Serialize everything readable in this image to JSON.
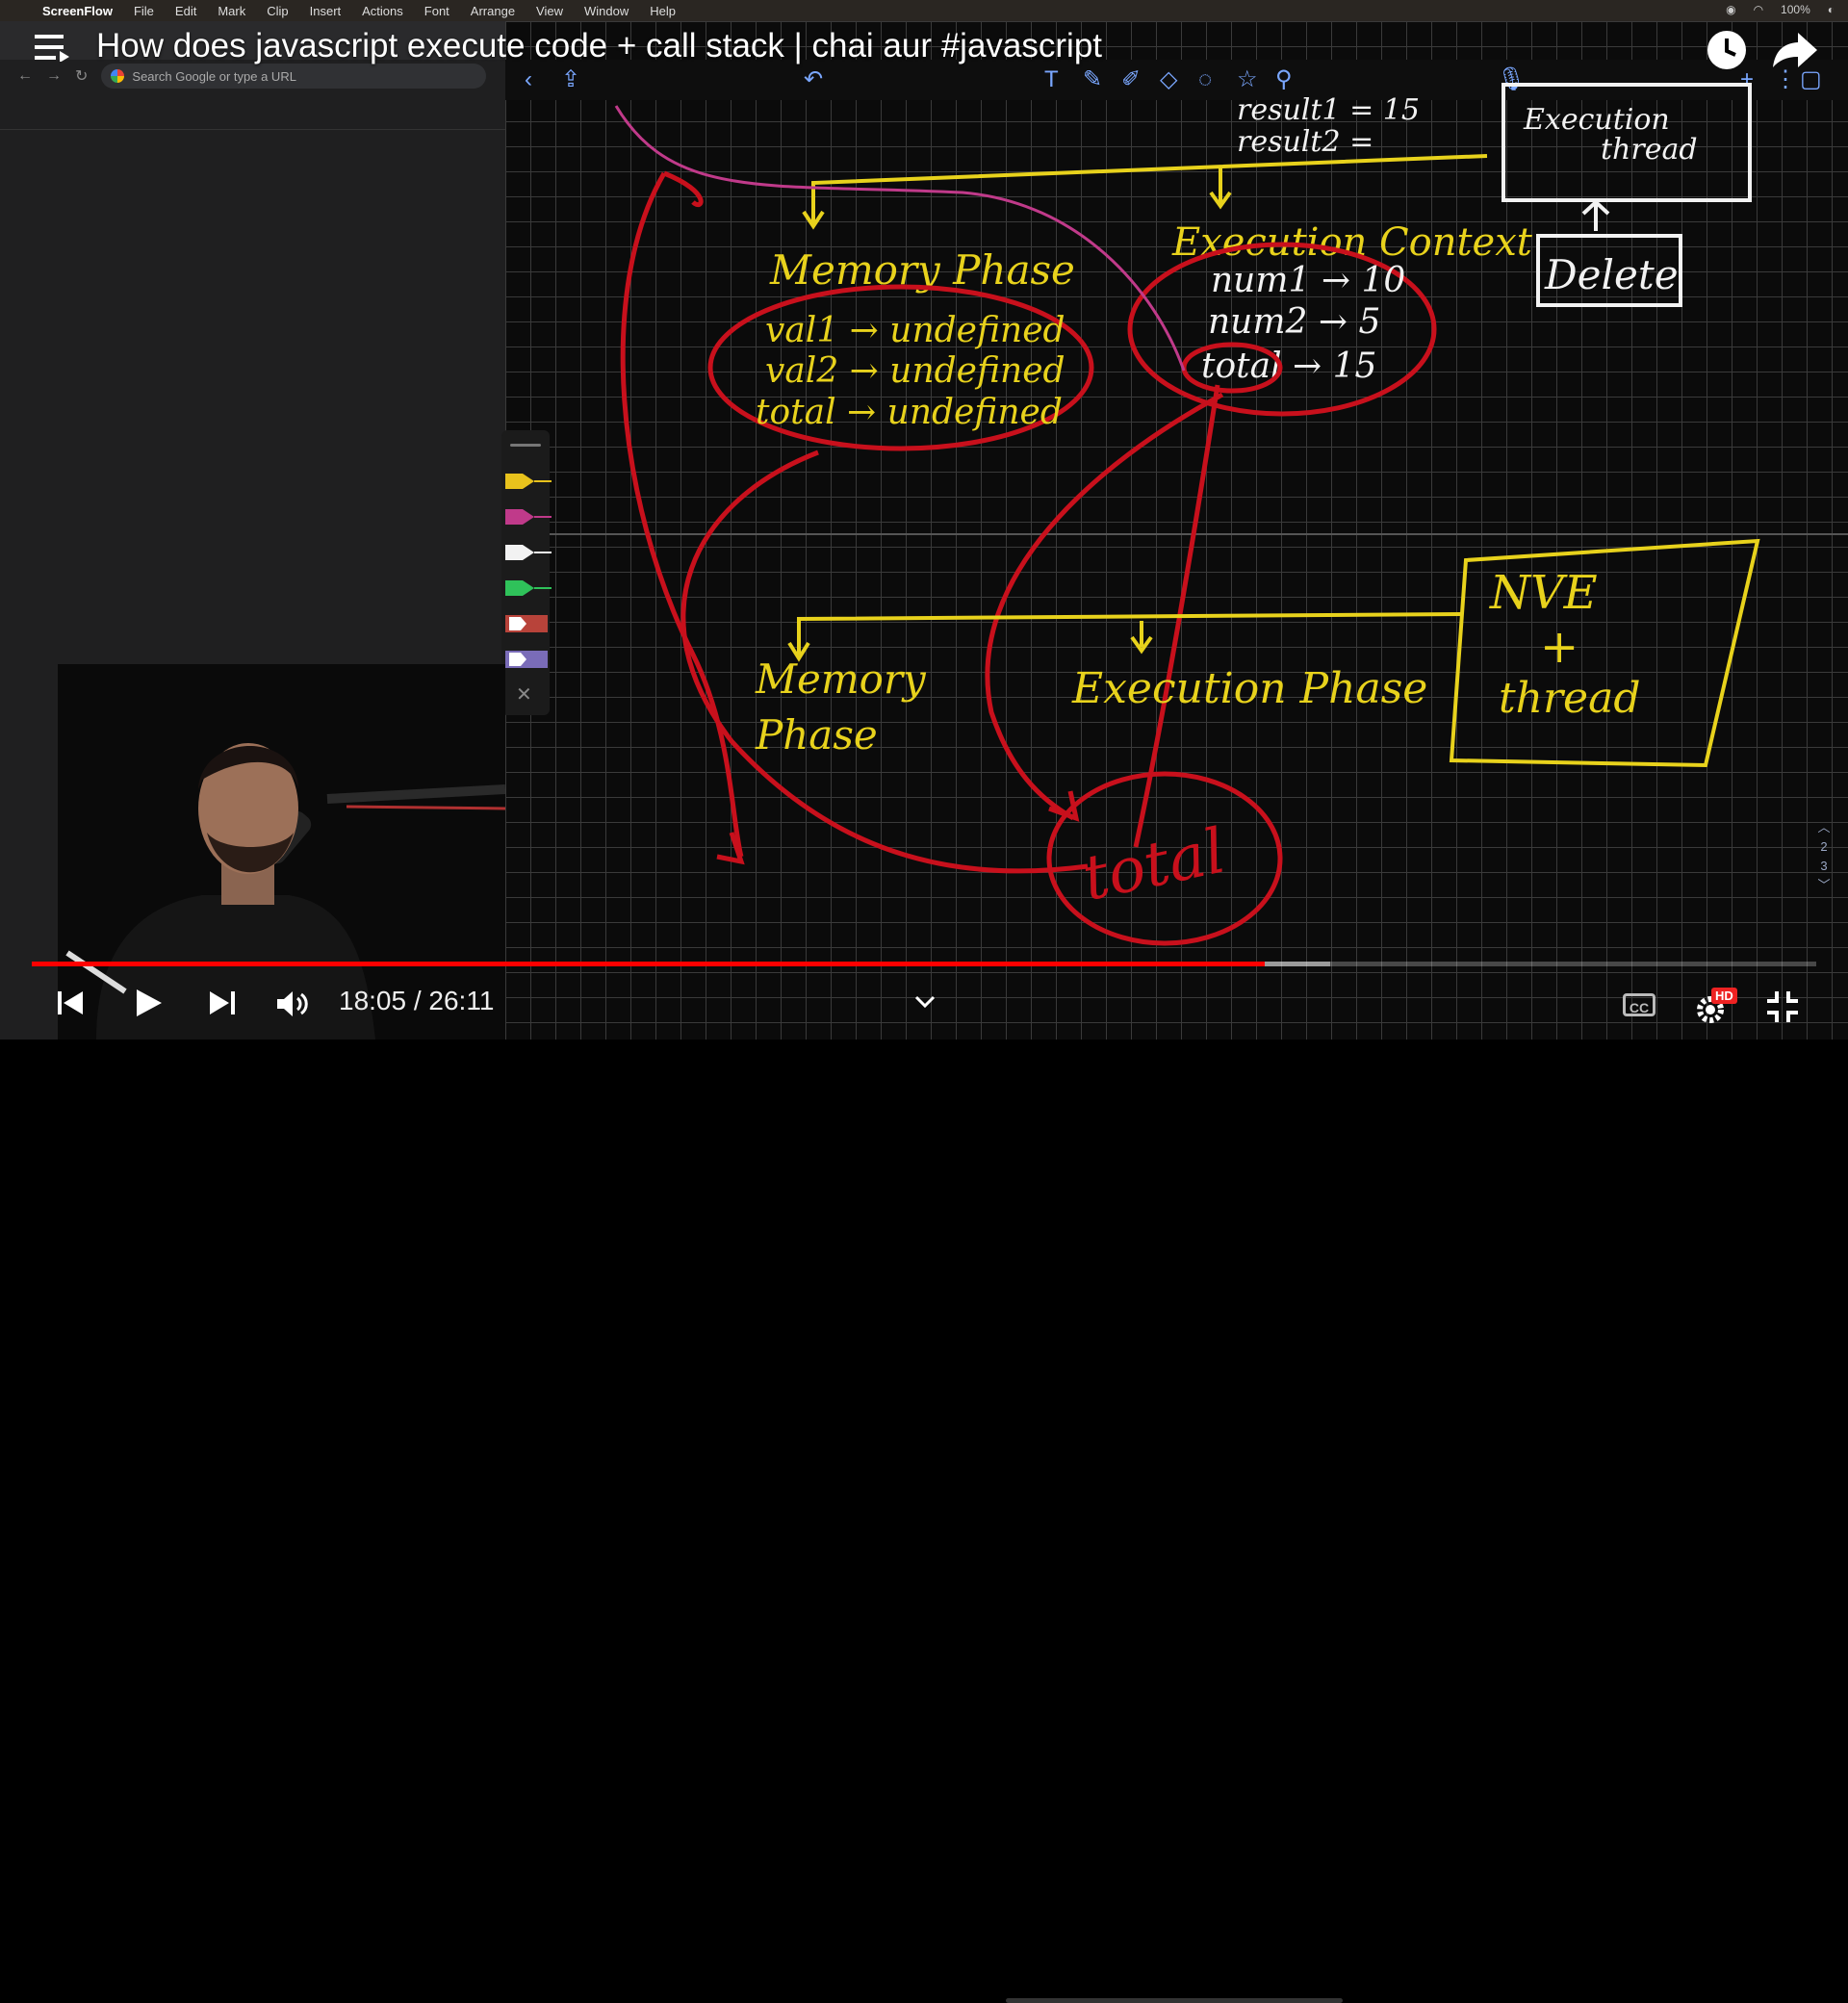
{
  "menubar": {
    "app": "ScreenFlow",
    "items": [
      "File",
      "Edit",
      "Mark",
      "Clip",
      "Insert",
      "Actions",
      "Font",
      "Arrange",
      "View",
      "Window",
      "Help"
    ],
    "battery": "100%"
  },
  "browser": {
    "omnibox_placeholder": "Search Google or type a URL"
  },
  "video": {
    "title": "How does javascript execute code + call stack | chai aur #javascript",
    "current_time": "18:05",
    "duration": "26:11",
    "time_display": "18:05 / 26:11",
    "played_fraction": 0.691,
    "buffered_fraction": 0.7275,
    "quality_badge": "HD",
    "cc_label": "CC"
  },
  "whiteboard": {
    "top_left_text": "result1 = 15",
    "top_left_text2": "result2 =",
    "execution_thread_box": [
      "Execution",
      "thread"
    ],
    "delete_label": "Delete",
    "memory_phase_title": "Memory Phase",
    "memory_entries": [
      "val1 → undefined",
      "val2 → undefined",
      "total → undefined"
    ],
    "execution_context_title": "Execution Context",
    "context_entries": [
      "num1 → 10",
      "num2 → 5",
      "total → 15"
    ],
    "nve_box": [
      "NVE",
      "+",
      "thread"
    ],
    "memory_phase_bottom": [
      "Memory",
      "Phase"
    ],
    "execution_phase_title": "Execution Phase",
    "total_circle": "total"
  },
  "pager": {
    "pages": [
      "2",
      "3"
    ]
  },
  "colors": {
    "ink_yellow": "#e8d21c",
    "ink_red": "#c8101c",
    "ink_white": "#f2f2f2",
    "ink_pink": "#c03a8a",
    "accent_blue": "#7aa7ff",
    "youtube_red": "#ff0000"
  },
  "pens": [
    "yellow-pen",
    "pink-pen",
    "white-pen",
    "green-pen",
    "red-highlighter",
    "purple-highlighter"
  ]
}
